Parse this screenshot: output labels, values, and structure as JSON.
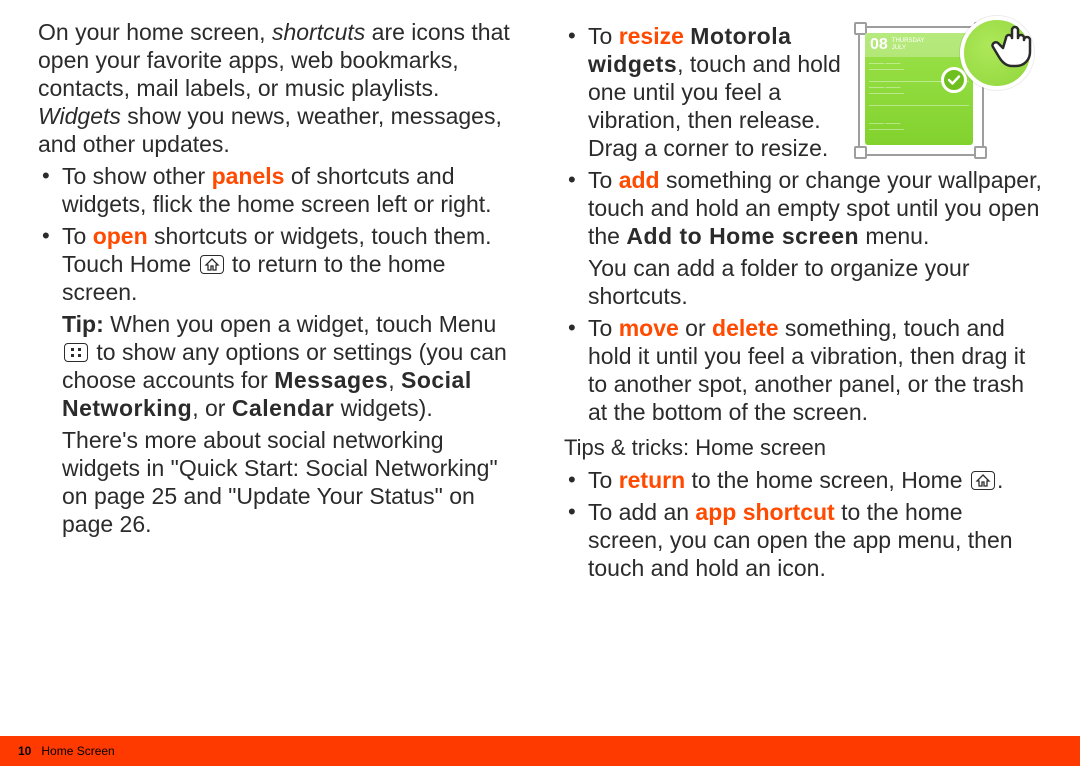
{
  "left": {
    "intro_a": "On your home screen, ",
    "intro_shortcuts": "shortcuts",
    "intro_b": " are icons that open your favorite apps, web bookmarks, contacts, mail labels, or music playlists. ",
    "intro_widgets": "Widgets",
    "intro_c": " show you news, weather, messages, and other updates.",
    "b1_a": "To show other ",
    "b1_panels": "panels",
    "b1_b": " of shortcuts and widgets, flick the home screen left or right.",
    "b2_a": "To ",
    "b2_open": "open",
    "b2_b": " shortcuts or widgets, touch them. Touch Home ",
    "b2_c": " to return to the home screen.",
    "tip_lead": "Tip: ",
    "tip_a": "When you open a widget, touch Menu ",
    "tip_b": " to show any options or settings (you can choose accounts for ",
    "tip_msg": "Messages",
    "tip_sep1": ", ",
    "tip_sn": "Social Networking",
    "tip_sep2": ", or ",
    "tip_cal": "Calendar",
    "tip_c": " widgets).",
    "more_a": "There's more about social networking widgets in \"Quick Start: Social Networking\" on page 25 and \"Update Your Status\" on page 26."
  },
  "right": {
    "r1_a": "To ",
    "r1_resize": "resize",
    "r1_sp": " ",
    "r1_moto": "Motorola widgets",
    "r1_b": ", touch and hold one until you feel a vibration, then release. Drag a corner to resize.",
    "r2_a": "To ",
    "r2_add": "add",
    "r2_b": " something or change your wallpaper, touch and hold an empty spot until you open the ",
    "r2_menu": "Add to Home screen",
    "r2_c": " menu.",
    "r2_d": "You can add a folder to organize your shortcuts.",
    "r3_a": "To ",
    "r3_move": "move",
    "r3_or": " or ",
    "r3_delete": "delete",
    "r3_b": " something, touch and hold it until you feel a vibration, then drag it to another spot, another panel, or the trash at the bottom of the screen.",
    "subhead": "Tips & tricks: Home screen",
    "t1_a": "To ",
    "t1_return": "return",
    "t1_b": " to the home screen, Home ",
    "t1_c": ".",
    "t2_a": "To add an ",
    "t2_app": "app shortcut",
    "t2_b": " to the home screen, you can open the app menu, then touch and hold an icon."
  },
  "widget": {
    "day_num": "08",
    "day_label_1": "THURSDAY",
    "day_label_2": "JULY"
  },
  "footer": {
    "page": "10",
    "section": "Home Screen"
  }
}
